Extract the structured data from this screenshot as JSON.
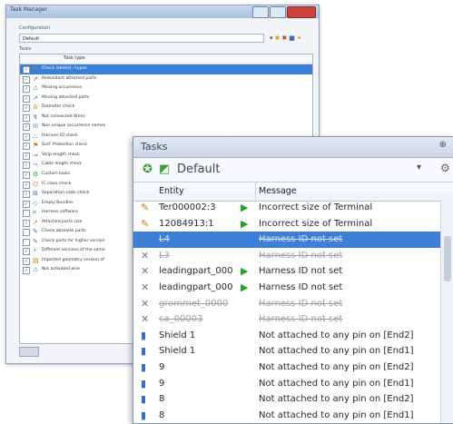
{
  "task_manager": {
    "title": "Task Manager",
    "configuration_label": "Configuration",
    "configuration_value": "Default",
    "tasks_label": "Tasks",
    "column_header": "Task type",
    "items": [
      {
        "label": "Check label(s) / types",
        "checked": true,
        "selected": true
      },
      {
        "label": "Redundant attached parts",
        "checked": true
      },
      {
        "label": "Missing occurrence",
        "checked": true
      },
      {
        "label": "Missing attached parts",
        "checked": true
      },
      {
        "label": "Diameter check",
        "checked": true
      },
      {
        "label": "Not connected Wires",
        "checked": true
      },
      {
        "label": "Non unique occurrence names",
        "checked": true
      },
      {
        "label": "Harness ID check",
        "checked": true
      },
      {
        "label": "Surf. Protection check",
        "checked": true
      },
      {
        "label": "Strip length check",
        "checked": true
      },
      {
        "label": "Cable length check",
        "checked": true
      },
      {
        "label": "Custom tasks",
        "checked": true
      },
      {
        "label": "IC class check",
        "checked": true
      },
      {
        "label": "Separation code check",
        "checked": true
      },
      {
        "label": "Empty Bundles",
        "checked": true
      },
      {
        "label": "Harness software",
        "checked": false
      },
      {
        "label": "Attached parts size",
        "checked": true
      },
      {
        "label": "Check obsolete parts",
        "checked": false
      },
      {
        "label": "Check parts for higher version",
        "checked": false
      },
      {
        "label": "Different versions of the same",
        "checked": true
      },
      {
        "label": "Imported geometry version of",
        "checked": true
      },
      {
        "label": "Not activated wire",
        "checked": true
      }
    ]
  },
  "tasks_panel": {
    "title": "Tasks",
    "configuration": "Default",
    "columns": {
      "entity": "Entity",
      "message": "Message"
    },
    "rows": [
      {
        "icon": "wrench-icon",
        "entity": "Ter000002:3",
        "arrow": true,
        "message": "Incorrect size of Terminal",
        "state": "normal"
      },
      {
        "icon": "wrench-icon",
        "entity": "12084913:1",
        "arrow": true,
        "message": "Incorrect size of Terminal",
        "state": "normal"
      },
      {
        "icon": "wire-icon",
        "entity": "L4",
        "arrow": false,
        "message": "Harness ID not set",
        "state": "selected"
      },
      {
        "icon": "wire-icon",
        "entity": "L3",
        "arrow": false,
        "message": "Harness ID not set",
        "state": "strike"
      },
      {
        "icon": "wire-icon",
        "entity": "leadingpart_000",
        "arrow": true,
        "message": "Harness ID not set",
        "state": "normal"
      },
      {
        "icon": "wire-icon",
        "entity": "leadingpart_000",
        "arrow": true,
        "message": "Harness ID not set",
        "state": "normal"
      },
      {
        "icon": "wire-icon",
        "entity": "grommet_0000",
        "arrow": false,
        "message": "Harness ID not set",
        "state": "strike"
      },
      {
        "icon": "wire-icon",
        "entity": "ca_00003",
        "arrow": false,
        "message": "Harness ID not set",
        "state": "strike"
      },
      {
        "icon": "pin-icon",
        "entity": "Shield 1",
        "arrow": false,
        "message": "Not attached to any pin on [End2]",
        "state": "normal"
      },
      {
        "icon": "pin-icon",
        "entity": "Shield 1",
        "arrow": false,
        "message": "Not attached to any pin on [End1]",
        "state": "normal"
      },
      {
        "icon": "pin-icon",
        "entity": "9",
        "arrow": false,
        "message": "Not attached to any pin on [End2]",
        "state": "normal"
      },
      {
        "icon": "pin-icon",
        "entity": "9",
        "arrow": false,
        "message": "Not attached to any pin on [End1]",
        "state": "normal"
      },
      {
        "icon": "pin-icon",
        "entity": "8",
        "arrow": false,
        "message": "Not attached to any pin on [End2]",
        "state": "normal"
      },
      {
        "icon": "pin-icon",
        "entity": "8",
        "arrow": false,
        "message": "Not attached to any pin on [End1]",
        "state": "normal"
      }
    ]
  }
}
